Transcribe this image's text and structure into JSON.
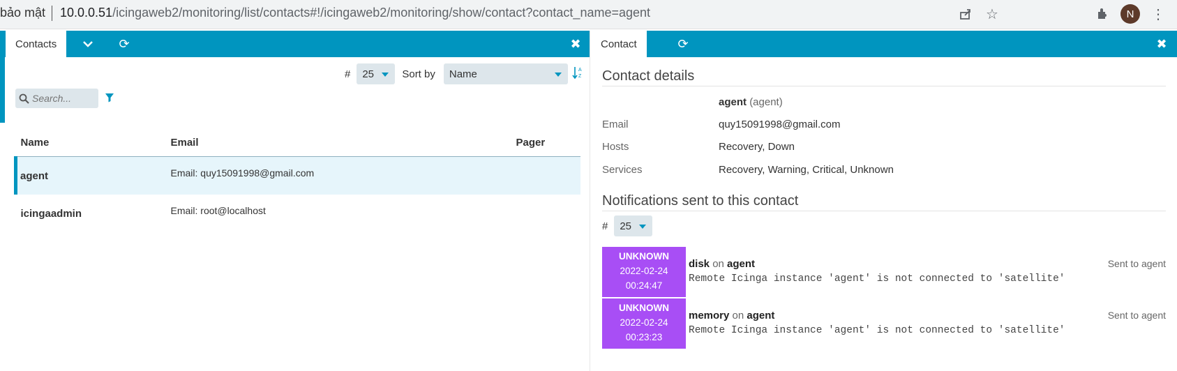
{
  "browser": {
    "security_text": "bảo mật",
    "url_host": "10.0.0.51",
    "url_path": "/icingaweb2/monitoring/list/contacts#!/icingaweb2/monitoring/show/contact?contact_name=agent",
    "avatar_initial": "N"
  },
  "left": {
    "tab_label": "Contacts",
    "limit_label": "#",
    "limit_value": "25",
    "sort_label": "Sort by",
    "sort_value": "Name",
    "search_placeholder": "Search...",
    "columns": [
      "Name",
      "Email",
      "Pager"
    ],
    "rows": [
      {
        "name": "agent",
        "email": "Email: quy15091998@gmail.com",
        "pager": ""
      },
      {
        "name": "icingaadmin",
        "email": "Email: root@localhost",
        "pager": ""
      }
    ]
  },
  "right": {
    "tab_label": "Contact",
    "details_title": "Contact details",
    "contact_name": "agent",
    "contact_alias": "(agent)",
    "fields": [
      {
        "label": "Email",
        "value": "quy15091998@gmail.com"
      },
      {
        "label": "Hosts",
        "value": "Recovery, Down"
      },
      {
        "label": "Services",
        "value": "Recovery, Warning, Critical, Unknown"
      }
    ],
    "notifications_title": "Notifications sent to this contact",
    "limit_label": "#",
    "limit_value": "25",
    "notifications": [
      {
        "state": "UNKNOWN",
        "date": "2022-02-24",
        "time": "00:24:47",
        "service": "disk",
        "on": "on",
        "host": "agent",
        "output": "Remote Icinga instance 'agent' is not connected to 'satellite'",
        "sent": "Sent to agent"
      },
      {
        "state": "UNKNOWN",
        "date": "2022-02-24",
        "time": "00:23:23",
        "service": "memory",
        "on": "on",
        "host": "agent",
        "output": "Remote Icinga instance 'agent' is not connected to 'satellite'",
        "sent": "Sent to agent"
      }
    ]
  },
  "colors": {
    "accent": "#0095bf",
    "unknown_state": "#a84ef5"
  }
}
